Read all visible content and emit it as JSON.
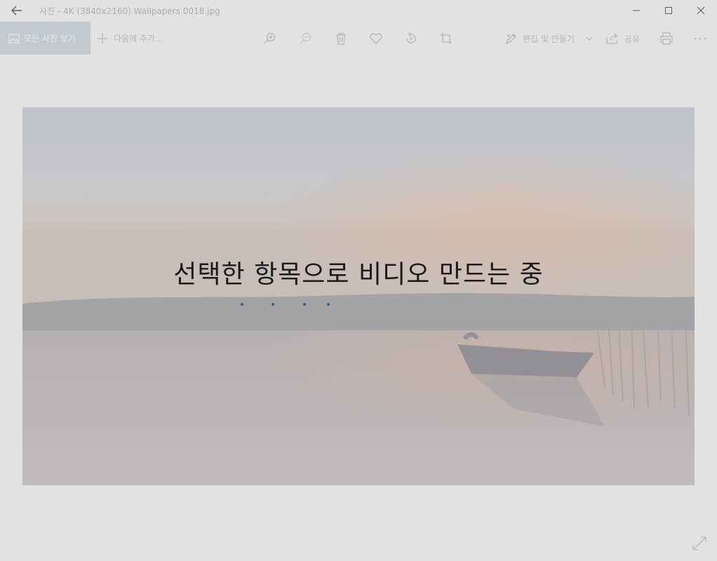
{
  "window": {
    "title": "사진 - 4K (3840x2160) Wallpapers 0018.jpg"
  },
  "toolbar": {
    "all_photos_label": "모든 사진 보기",
    "add_to_label": "다음에 추가...",
    "edit_create_label": "편집 및 만들기",
    "share_label": "공유"
  },
  "overlay": {
    "message": "선택한 항목으로 비디오 만드는 중"
  },
  "colors": {
    "accent": "#2f5f8f",
    "all_photos_bg": "#bfcbd6"
  },
  "icons": {
    "back": "arrow-left-icon",
    "minimize": "minimize-icon",
    "maximize": "maximize-icon",
    "close": "close-icon",
    "zoom_in": "zoom-in-icon",
    "zoom_out": "zoom-out-icon",
    "delete": "trash-icon",
    "favorite": "heart-icon",
    "rotate": "rotate-icon",
    "crop": "crop-icon",
    "edit": "edit-icon",
    "share": "share-icon",
    "print": "print-icon",
    "more": "more-icon",
    "expand": "expand-icon"
  }
}
